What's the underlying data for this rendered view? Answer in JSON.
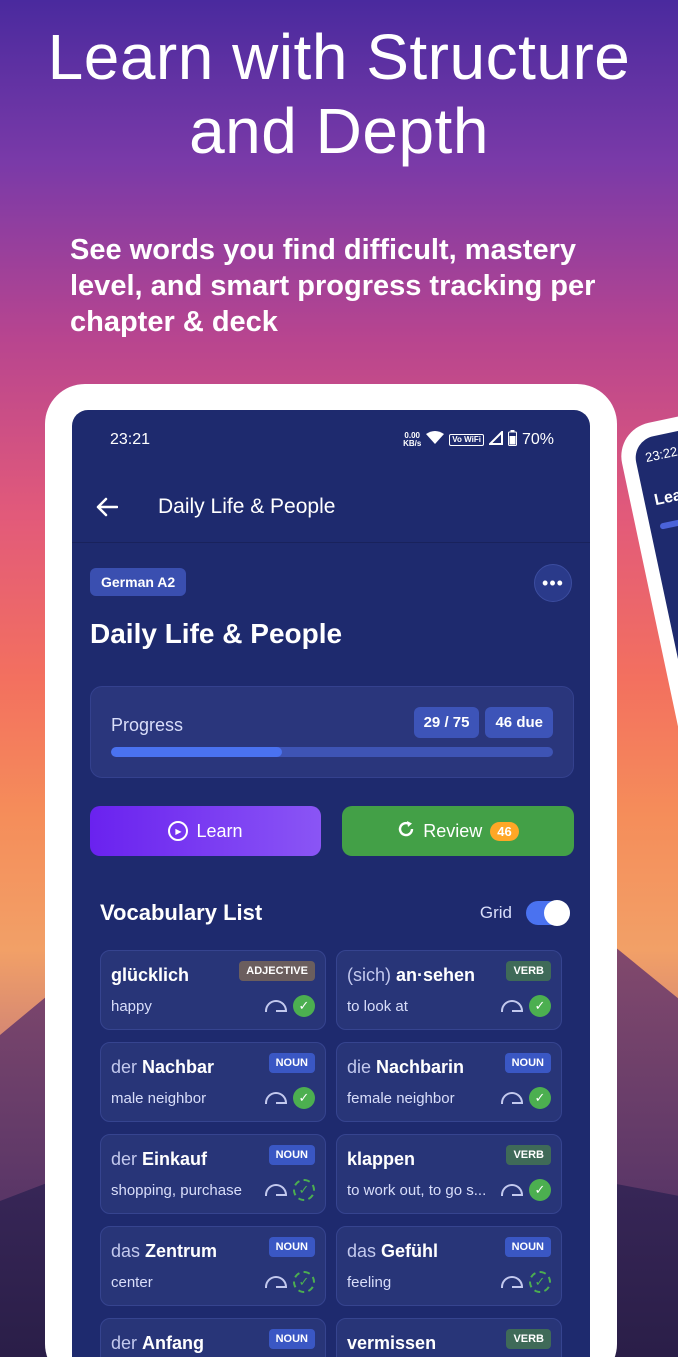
{
  "headline": "Learn with Structure and Depth",
  "subline": "See words you find difficult, mastery level, and smart progress tracking per chapter & deck",
  "phone2": {
    "time": "23:22",
    "title": "Learn"
  },
  "status": {
    "time": "23:21",
    "net_rate": "0.00",
    "net_unit": "KB/s",
    "wifi_label": "Vo WiFi",
    "battery": "70%"
  },
  "topbar": {
    "title": "Daily Life & People"
  },
  "deck": {
    "chip": "German A2",
    "more": "•••",
    "title": "Daily Life & People"
  },
  "progress": {
    "label": "Progress",
    "count": "29 / 75",
    "due": "46 due",
    "fraction": 0.387
  },
  "buttons": {
    "learn": "Learn",
    "review": "Review",
    "review_badge": "46"
  },
  "vocab": {
    "title": "Vocabulary List",
    "grid_label": "Grid",
    "grid_on": true,
    "items": [
      {
        "article": "",
        "term": "glücklich",
        "tag": "ADJECTIVE",
        "tag_type": "adj",
        "meaning": "happy",
        "mastered": true
      },
      {
        "article": "(sich) ",
        "term": "an·sehen",
        "tag": "VERB",
        "tag_type": "verb",
        "meaning": "to look at",
        "mastered": true
      },
      {
        "article": "der ",
        "term": "Nachbar",
        "tag": "NOUN",
        "tag_type": "noun",
        "meaning": "male neighbor",
        "mastered": true
      },
      {
        "article": "die ",
        "term": "Nachbarin",
        "tag": "NOUN",
        "tag_type": "noun",
        "meaning": "female neighbor",
        "mastered": true
      },
      {
        "article": "der ",
        "term": "Einkauf",
        "tag": "NOUN",
        "tag_type": "noun",
        "meaning": "shopping, purchase",
        "mastered": false
      },
      {
        "article": "",
        "term": "klappen",
        "tag": "VERB",
        "tag_type": "verb",
        "meaning": "to work out, to go s...",
        "mastered": true
      },
      {
        "article": "das ",
        "term": "Zentrum",
        "tag": "NOUN",
        "tag_type": "noun",
        "meaning": "center",
        "mastered": false
      },
      {
        "article": "das ",
        "term": "Gefühl",
        "tag": "NOUN",
        "tag_type": "noun",
        "meaning": "feeling",
        "mastered": false
      },
      {
        "article": "der ",
        "term": "Anfang",
        "tag": "NOUN",
        "tag_type": "noun",
        "meaning": "",
        "mastered": false
      },
      {
        "article": "",
        "term": "vermissen",
        "tag": "VERB",
        "tag_type": "verb",
        "meaning": "",
        "mastered": false
      }
    ]
  },
  "icons": {
    "back": "arrow-left-icon",
    "wifi": "wifi-icon",
    "signal": "signal-icon",
    "battery": "battery-icon",
    "play": "play-circle-icon",
    "refresh": "refresh-icon",
    "gauge": "gauge-icon",
    "check": "check-circle-icon"
  },
  "colors": {
    "screen_bg": "#1e2a6e",
    "accent": "#4a72f0",
    "learn": "#6a22ef",
    "review": "#43a047",
    "badge": "#ffa726"
  }
}
